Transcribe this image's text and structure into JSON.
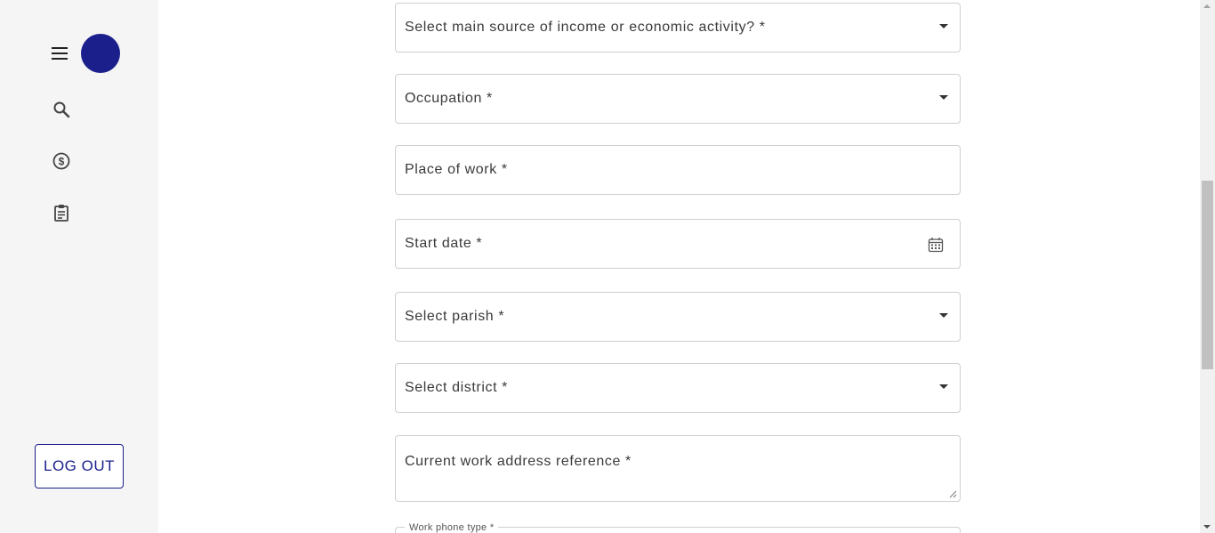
{
  "sidebar": {
    "menu_icon": "menu-icon",
    "avatar_color": "#1a1f8c",
    "nav_icons": [
      "search-icon",
      "dollar-circle-icon",
      "clipboard-icon"
    ],
    "logout_label": "LOG OUT"
  },
  "form": {
    "fields": [
      {
        "label": "Select main source of income or economic activity? *",
        "type": "select"
      },
      {
        "label": "Occupation *",
        "type": "select"
      },
      {
        "label": "Place of work *",
        "type": "text"
      },
      {
        "label": "Start date *",
        "type": "date"
      },
      {
        "label": "Select parish *",
        "type": "select"
      },
      {
        "label": "Select district *",
        "type": "select"
      },
      {
        "label": "Current work address reference *",
        "type": "textarea"
      }
    ],
    "work_phone_type_label": "Work phone type *"
  },
  "colors": {
    "accent": "#1a1f8c",
    "border": "#cfcfcf",
    "sidebar_bg": "#f5f5f5"
  }
}
